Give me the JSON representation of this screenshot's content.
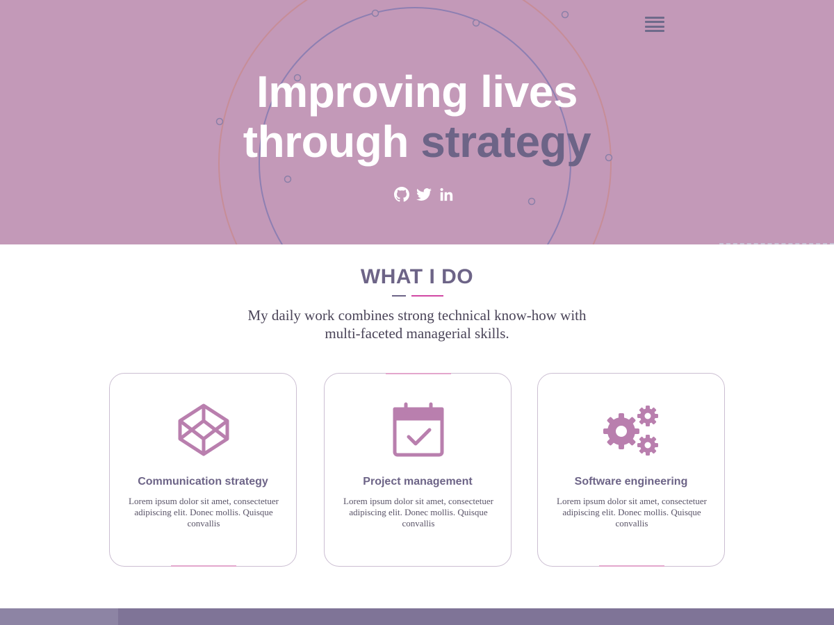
{
  "hero": {
    "title_line1": "Improving lives",
    "title_line2_plain": "through ",
    "title_line2_accent": "strategy",
    "background_color": "#c399b8",
    "accent_color": "#6d6487",
    "social": [
      {
        "icon": "github-icon"
      },
      {
        "icon": "twitter-icon"
      },
      {
        "icon": "linkedin-icon"
      }
    ],
    "menu_icon": "hamburger-menu-icon"
  },
  "what_i_do": {
    "title": "WHAT I DO",
    "subtitle": "My daily work combines strong technical know-how with multi-faceted managerial skills.",
    "cards": [
      {
        "icon": "codepen-cube-icon",
        "title": "Communication strategy",
        "text": "Lorem ipsum dolor sit amet, consectetuer adipiscing elit. Donec mollis. Quisque convallis"
      },
      {
        "icon": "calendar-check-icon",
        "title": "Project management",
        "text": "Lorem ipsum dolor sit amet, consectetuer adipiscing elit. Donec mollis. Quisque convallis"
      },
      {
        "icon": "gears-icon",
        "title": "Software engineering",
        "text": "Lorem ipsum dolor sit amet, consectetuer adipiscing elit. Donec mollis. Quisque convallis"
      }
    ],
    "icon_color": "#b97fae",
    "title_color": "#6d6487"
  }
}
